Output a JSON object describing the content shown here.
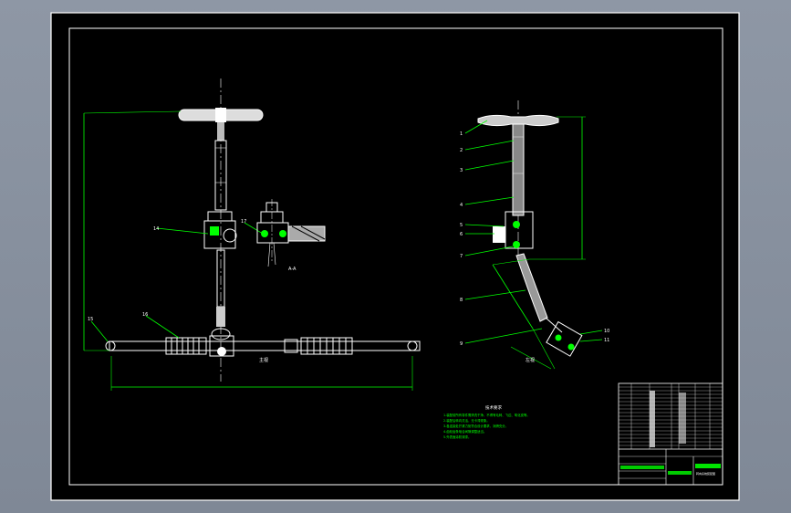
{
  "colors": {
    "background": "#8c95a3",
    "sheet": "#000000",
    "frame": "#ffffff",
    "leader": "#00ff00",
    "centerline": "#ffffff"
  },
  "views": {
    "front": {
      "view_label": "主视",
      "section_label": "A-A",
      "leaders": [
        {
          "id": "14"
        },
        {
          "id": "15"
        },
        {
          "id": "16"
        },
        {
          "id": "17"
        }
      ]
    },
    "side": {
      "view_label": "左视",
      "leaders": [
        {
          "id": "1"
        },
        {
          "id": "2"
        },
        {
          "id": "3"
        },
        {
          "id": "4"
        },
        {
          "id": "5"
        },
        {
          "id": "6"
        },
        {
          "id": "7"
        },
        {
          "id": "8"
        },
        {
          "id": "9"
        },
        {
          "id": "10"
        },
        {
          "id": "11"
        }
      ]
    }
  },
  "notes": {
    "title": "技术要求",
    "lines": [
      "1.装配前所有零件需清洗干净，不得有毛刺、飞边、氧化皮等。",
      "2.装配后转向灵活，无卡滞现象。",
      "3.各连接处拧紧力矩符合设计要求，润滑充分。",
      "4.齿轮齿条啮合间隙调整适当。",
      "5.外表面涂防锈漆。"
    ]
  },
  "title_block": {
    "drawing_title": "转向系统装配图",
    "rows": 18
  }
}
